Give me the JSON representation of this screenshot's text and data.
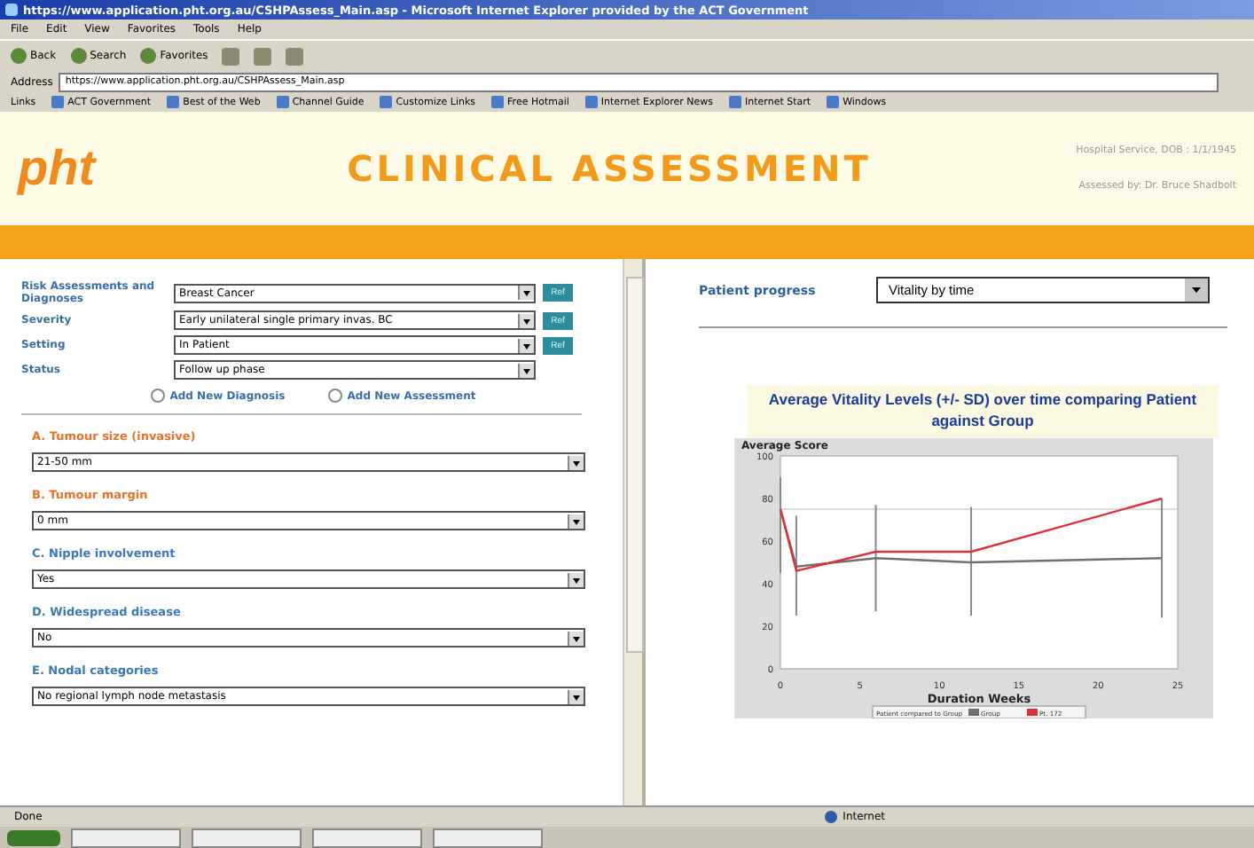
{
  "window": {
    "title": "https://www.application.pht.org.au/CSHPAssess_Main.asp - Microsoft Internet Explorer provided by the ACT Government"
  },
  "menu": [
    "File",
    "Edit",
    "View",
    "Favorites",
    "Tools",
    "Help"
  ],
  "toolbar": [
    "Back",
    "Search",
    "Favorites"
  ],
  "address": {
    "label": "Address",
    "value": "https://www.application.pht.org.au/CSHPAssess_Main.asp"
  },
  "links": {
    "label": "Links",
    "items": [
      "ACT Government",
      "Best of the Web",
      "Channel Guide",
      "Customize Links",
      "Free Hotmail",
      "Internet Explorer News",
      "Internet Start",
      "Windows"
    ]
  },
  "header": {
    "logo": "pht",
    "title": "CLINICAL ASSESSMENT",
    "info": [
      "Hospital Service, DOB : 1/1/1945",
      "Assessed by: Dr. Bruce Shadbolt"
    ]
  },
  "form": {
    "fields": [
      {
        "label": "Risk Assessments and Diagnoses",
        "value": "Breast Cancer",
        "button": "Ref"
      },
      {
        "label": "Severity",
        "value": "Early unilateral single primary invas. BC",
        "button": "Ref"
      },
      {
        "label": "Setting",
        "value": "In Patient",
        "button": "Ref"
      },
      {
        "label": "Status",
        "value": "Follow up phase"
      }
    ],
    "radios": [
      {
        "label": "Add New Diagnosis",
        "selected": false
      },
      {
        "label": "Add New Assessment",
        "selected": false
      }
    ]
  },
  "sections": [
    {
      "heading": "A. Tumour size (invasive)",
      "color": "#e8742a",
      "value": "21-50 mm"
    },
    {
      "heading": "B. Tumour margin",
      "color": "#e8742a",
      "value": "0 mm"
    },
    {
      "heading": "C. Nipple involvement",
      "color": "#3a78b8",
      "value": "Yes"
    },
    {
      "heading": "D. Widespread disease",
      "color": "#3a78b8",
      "value": "No"
    },
    {
      "heading": "E. Nodal categories",
      "color": "#3a78b8",
      "value": "No regional lymph node metastasis"
    }
  ],
  "progress": {
    "label": "Patient progress",
    "value": "Vitality by time",
    "chart_title": "Average Vitality Levels (+/- SD) over time comparing Patient against Group",
    "chart_data": {
      "type": "line",
      "ylabel": "Average Score",
      "xlabel": "Duration Weeks",
      "x": [
        0,
        1,
        6,
        12,
        24
      ],
      "xlim": [
        0,
        25
      ],
      "ylim": [
        0,
        100
      ],
      "xticks": [
        0,
        5,
        10,
        15,
        20,
        25
      ],
      "yticks": [
        0,
        20,
        40,
        60,
        80,
        100
      ],
      "series": [
        {
          "name": "Group",
          "color": "#707070",
          "values": [
            75,
            48,
            52,
            50,
            52
          ],
          "errors": [
            [
              45,
              90
            ],
            [
              25,
              72
            ],
            [
              27,
              77
            ],
            [
              25,
              76
            ],
            [
              24,
              80
            ]
          ]
        },
        {
          "name": "Pt. 172",
          "color": "#e0303a",
          "values": [
            75,
            46,
            55,
            55,
            80
          ]
        }
      ],
      "ref_lines": [
        {
          "value": 75,
          "axis": "y"
        }
      ],
      "legend": {
        "title": "Patient compared to Group"
      }
    }
  },
  "status_bar": {
    "text": "Done",
    "zone": "Internet"
  }
}
